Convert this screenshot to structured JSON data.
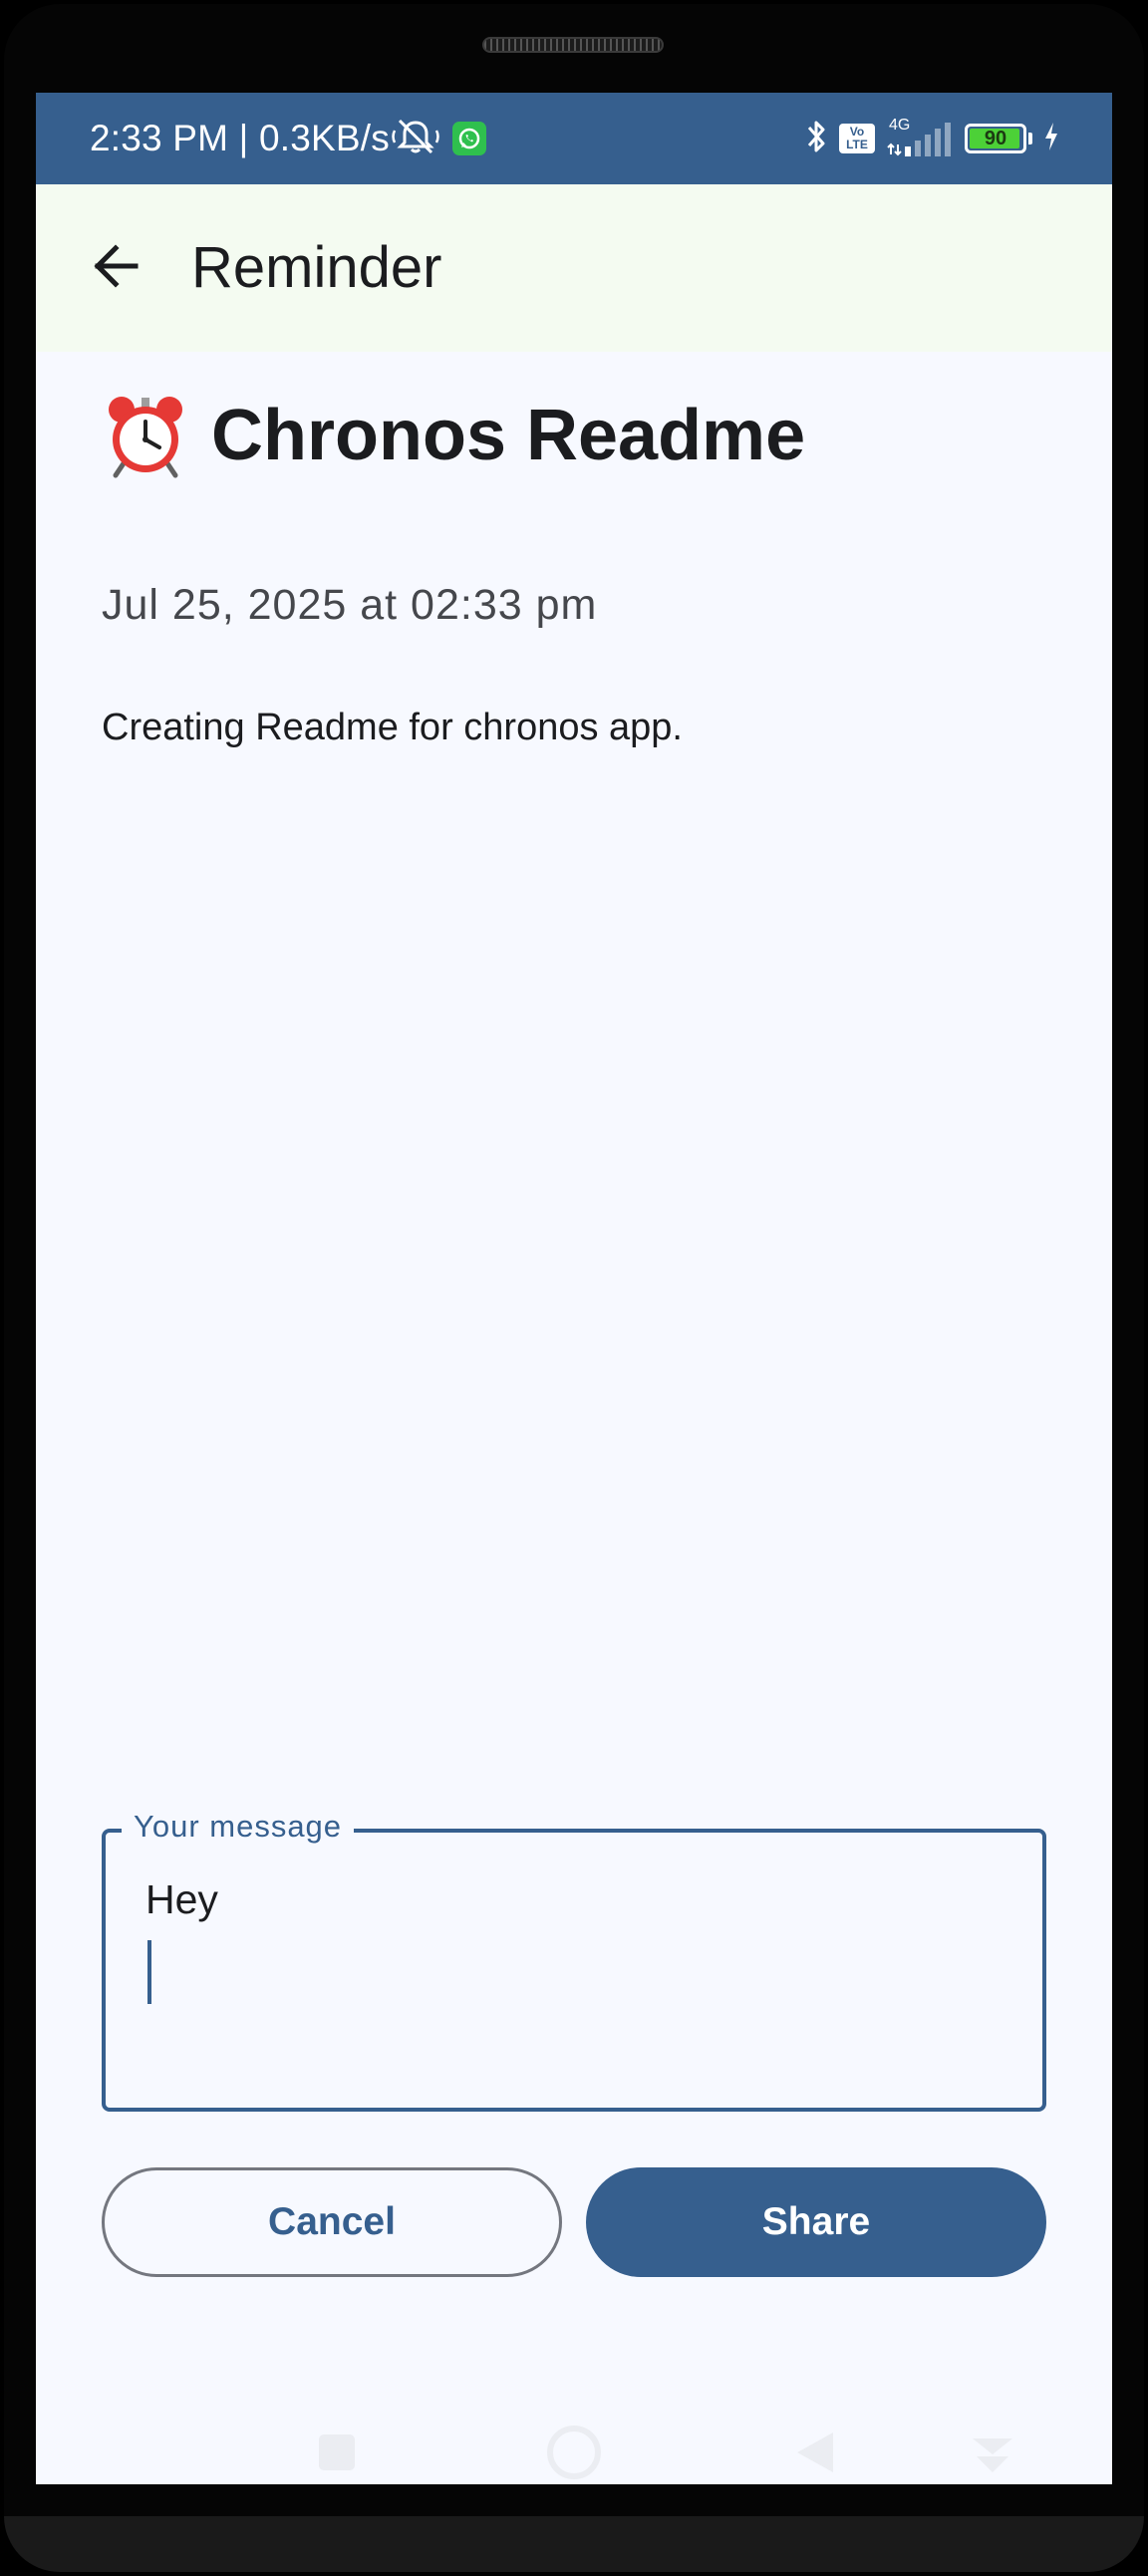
{
  "status_bar": {
    "time": "2:33 PM | 0.3KB/s",
    "network_type": "4G",
    "volte_line1": "Vo",
    "volte_line2": "LTE",
    "battery_level": "90"
  },
  "app_bar": {
    "title": "Reminder"
  },
  "reminder": {
    "title": "Chronos Readme",
    "date": "Jul 25, 2025 at 02:33 pm",
    "description": "Creating Readme for chronos app."
  },
  "message_field": {
    "label": "Your message",
    "value": "Hey"
  },
  "actions": {
    "cancel_label": "Cancel",
    "share_label": "Share"
  },
  "colors": {
    "primary": "#365f8e",
    "surface": "#f7f9ff",
    "app_bar": "#f4fbf1",
    "on_surface": "#1b1c1f"
  },
  "icons": {
    "back": "arrow-left-icon",
    "title_emoji": "alarm-clock-icon",
    "nav": [
      "recents-icon",
      "home-icon",
      "back-icon",
      "accessibility-icon"
    ]
  }
}
